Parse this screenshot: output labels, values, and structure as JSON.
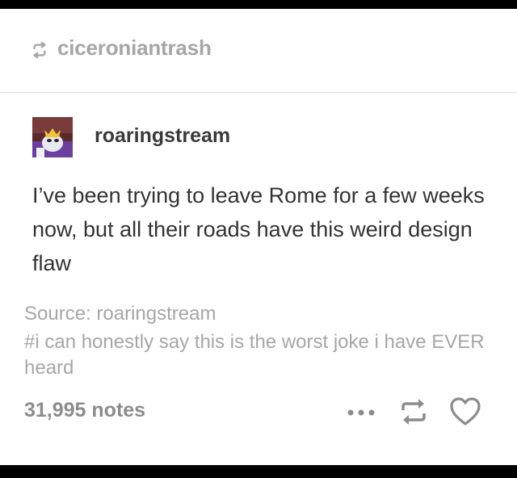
{
  "reblog": {
    "username": "ciceroniantrash",
    "icon": "reblog-icon"
  },
  "post": {
    "author": "roaringstream",
    "avatar_icon": "avatar",
    "body": "I’ve been trying to leave Rome for a few weeks now, but all their roads have this weird design flaw",
    "source": "Source: roaringstream",
    "tags": "#i can honestly say this is the worst joke i have EVER heard"
  },
  "footer": {
    "notes": "31,995 notes",
    "more_icon": "more-icon",
    "reblog_icon": "reblog-icon",
    "like_icon": "heart-icon"
  },
  "colors": {
    "muted": "#a6a6a6",
    "text": "#333333",
    "frame": "#000000"
  }
}
